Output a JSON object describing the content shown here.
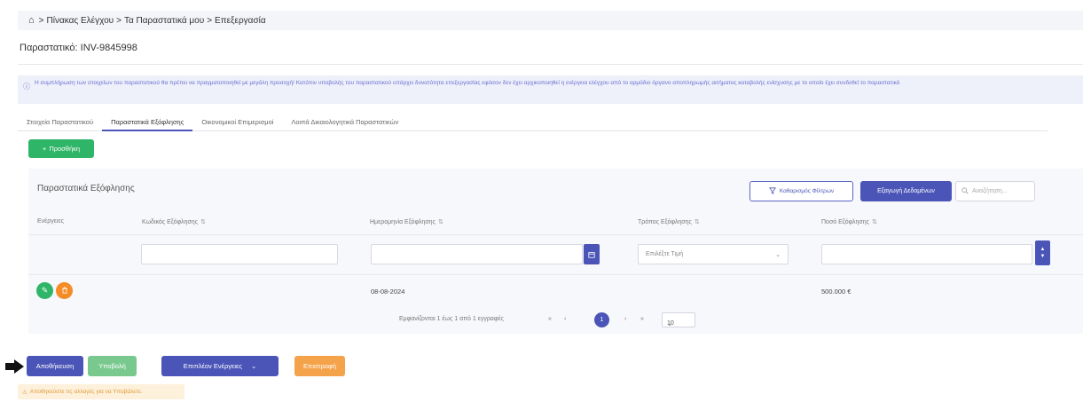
{
  "breadcrumb": {
    "home_icon": "home-icon",
    "separator": ">",
    "items": [
      "Πίνακας Ελέγχου",
      "Τα Παραστατικά μου",
      "Επεξεργασία"
    ]
  },
  "page_title": "Παραστατικό: INV-9845998",
  "info": {
    "icon": "info-circle-icon",
    "text": "Η συμπλήρωση των στοιχείων του παραστατικού θα πρέπει να πραγματοποιηθεί με μεγάλη προσοχή! Κατόπιν υποβολής του παραστατικού υπάρχει δυνατότητα επεξεργασίας εφόσον δεν έχει αρχικοποιηθεί η ενέργεια ελέγχου από το αρμόδιο όργανο αποπληρωμής αιτήματος καταβολής ενίσχυσης με το οποίο έχει συνδεθεί το παραστατικό"
  },
  "tabs": [
    {
      "label": "Στοιχεία Παραστατικού",
      "active": false
    },
    {
      "label": "Παραστατικά Εξόφλησης",
      "active": true
    },
    {
      "label": "Οικονομικοί Επιμερισμοί",
      "active": false
    },
    {
      "label": "Λοιπά Δικαιολογητικά Παραστατικών",
      "active": false
    }
  ],
  "add_button": {
    "icon": "+",
    "label": "Προσθήκη"
  },
  "panel": {
    "title": "Παραστατικά Εξόφλησης",
    "clear_filters_label": "Καθαρισμός Φίλτρων",
    "export_label": "Εξαγωγή Δεδομένων",
    "search_placeholder": "Αναζήτηση..."
  },
  "table": {
    "columns": [
      "Ενέργειες",
      "Κωδικός Εξόφλησης",
      "Ημερομηνία Εξόφλησης",
      "Τρόπος Εξόφλησης",
      "Ποσό Εξόφλησης"
    ],
    "sort_symbol": "⇅",
    "method_filter_placeholder": "Επιλέξτε Τιμή",
    "rows": [
      {
        "code": "",
        "date": "08-08-2024",
        "method": "",
        "amount": "500.000 €"
      }
    ]
  },
  "pagination": {
    "summary": "Εμφανίζονται 1 έως 1 από 1 εγγραφές",
    "first": "«",
    "prev": "‹",
    "current_page": "1",
    "next": "›",
    "last": "»",
    "page_size": "10"
  },
  "actions": {
    "save": "Αποθήκευση",
    "submit": "Υποβολή",
    "more": "Επιπλέον Ενέργειες",
    "back": "Επιστροφή"
  },
  "warning": {
    "icon": "⚠",
    "text": "Αποθηκεύστε τις αλλαγές για να Υποβάλετε."
  },
  "colors": {
    "primary": "#4b55b8",
    "success": "#2fb567",
    "warning": "#f58c28"
  }
}
